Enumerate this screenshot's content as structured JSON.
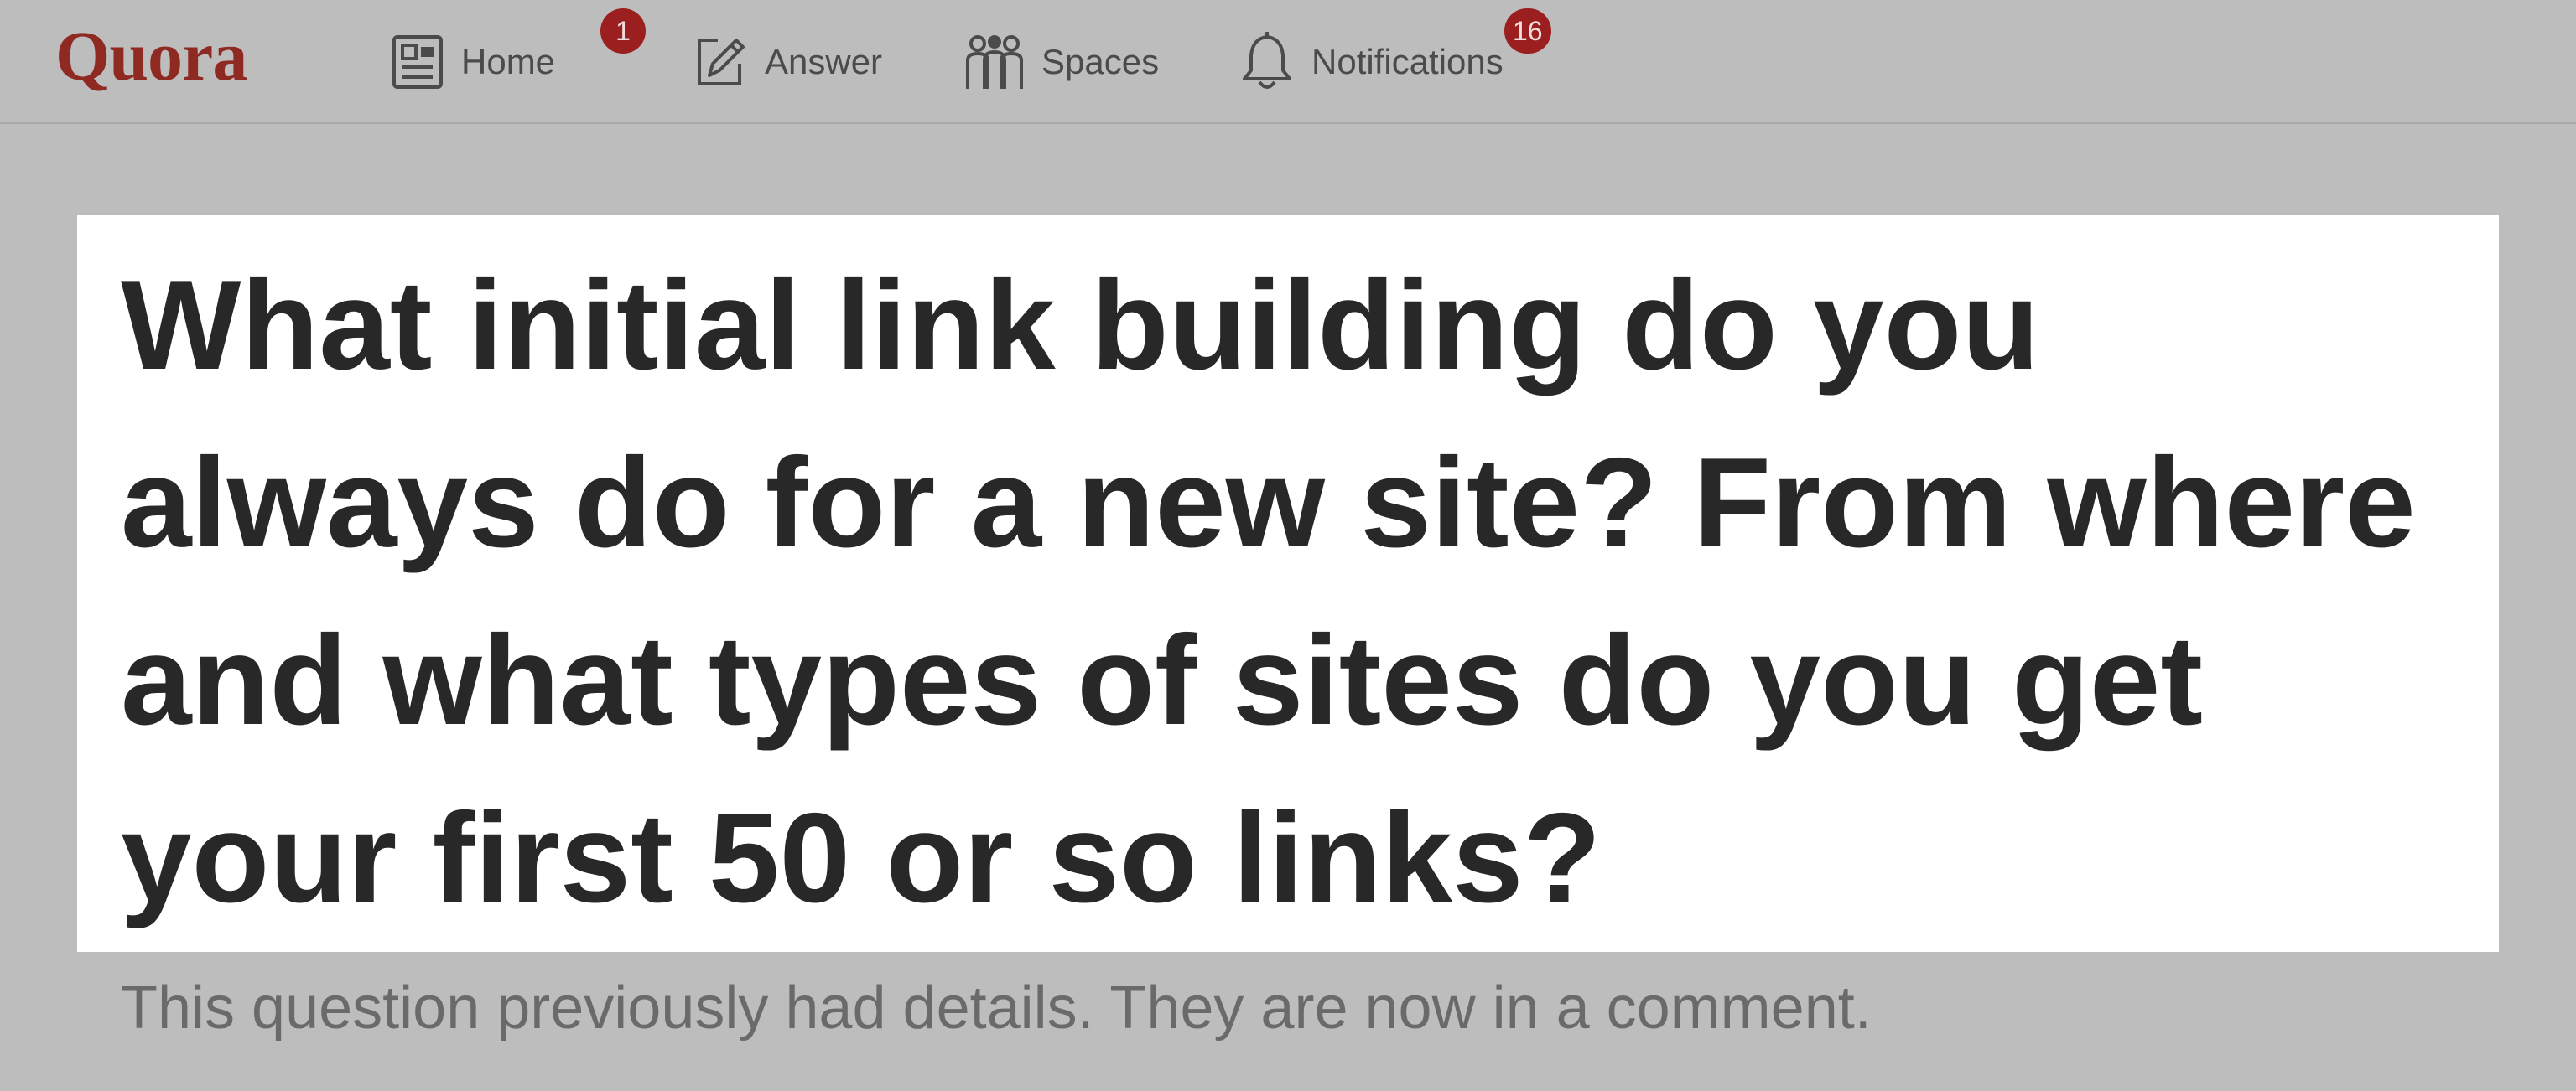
{
  "header": {
    "logo": "Quora",
    "nav": {
      "home": {
        "label": "Home",
        "badge": "1",
        "icon": "newspaper-icon"
      },
      "answer": {
        "label": "Answer",
        "icon": "pencil-square-icon"
      },
      "spaces": {
        "label": "Spaces",
        "icon": "people-group-icon"
      },
      "notifications": {
        "label": "Notifications",
        "badge": "16",
        "icon": "bell-icon"
      }
    },
    "colors": {
      "brand": "#8f2a22",
      "badge": "#9b1f1f"
    }
  },
  "question": {
    "title": "What initial link building do you always do for a new site? From where and what types of sites do you get your first 50 or so links?",
    "note": "This question previously had details. They are now in a comment."
  }
}
